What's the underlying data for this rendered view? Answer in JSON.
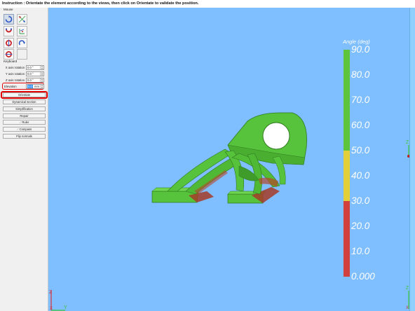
{
  "instruction": "Instruction : Orientate the element according to the views, then click on Orientate to validate the position.",
  "mouse": {
    "title": "Mouse",
    "tools": [
      {
        "icon": "rotate-view-icon",
        "selected": true
      },
      {
        "icon": "grid-points-icon",
        "selected": false
      },
      {
        "icon": "magnet-rotate-icon",
        "selected": false
      },
      {
        "icon": "axis-rotate-icon",
        "selected": false
      },
      {
        "icon": "red-rotate-vertical-icon",
        "selected": false
      },
      {
        "icon": "redo-arrow-icon",
        "selected": false
      },
      {
        "icon": "red-rotate-horizontal-icon",
        "selected": false
      }
    ]
  },
  "keyboard": {
    "title": "Keyboard",
    "rows": [
      {
        "label": "X axis rotation",
        "value": "0.0 °"
      },
      {
        "label": "Y axis rotation",
        "value": "0.0 °"
      },
      {
        "label": "Z axis rotation",
        "value": "0.0 °"
      }
    ],
    "elevation": {
      "label": "Elevation",
      "value": "0.0",
      "unit": "mm"
    }
  },
  "buttons": [
    "Orientate",
    "Dynamical section",
    "Simplification",
    "Repair",
    "Ruler",
    "Compass",
    "Flip normals"
  ],
  "colorbar": {
    "title": "Angle (deg)",
    "labels": [
      "90.0",
      "80.0",
      "70.0",
      "60.0",
      "50.0",
      "40.0",
      "30.0",
      "20.0",
      "10.0",
      "0.000"
    ],
    "colors": {
      "green": "#5ec43c",
      "yellow": "#e2cf3a",
      "red": "#d2403e"
    },
    "green_from_deg": 50,
    "yellow_from_deg": 30
  },
  "colors": {
    "viewport": "#7fbfff",
    "part": "#57c23b",
    "highlight": "#e00000"
  }
}
